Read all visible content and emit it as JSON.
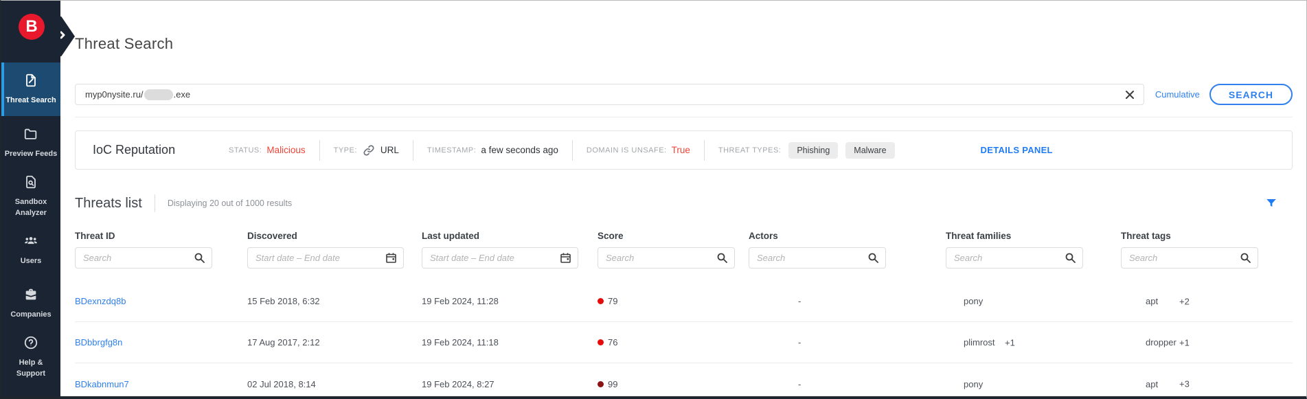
{
  "colors": {
    "sidebar_bg": "#1b2433",
    "sidebar_active_bg": "#1d4a70",
    "accent_blue": "#2f80ed",
    "funnel_blue": "#1f7cf5",
    "logo_red": "#e8192c",
    "status_red": "#f04438",
    "score_high_red": "#e60b0b",
    "score_critical_red": "#8b1313"
  },
  "sidebar": {
    "logo_letter": "B",
    "items": [
      {
        "label": "Threat Search",
        "active": true
      },
      {
        "label": "Preview Feeds",
        "active": false
      },
      {
        "label": "Sandbox Analyzer",
        "active": false
      },
      {
        "label": "Users",
        "active": false
      },
      {
        "label": "Companies",
        "active": false
      },
      {
        "label": "Help & Support",
        "active": false
      }
    ]
  },
  "header": {
    "title": "Threat Search"
  },
  "search": {
    "value_prefix": "myp0nysite.ru/",
    "value_suffix": ".exe",
    "cumulative_label": "Cumulative",
    "search_button_label": "SEARCH"
  },
  "ioc": {
    "title": "IoC Reputation",
    "status_label": "STATUS:",
    "status_value": "Malicious",
    "type_label": "TYPE:",
    "type_value": "URL",
    "timestamp_label": "TIMESTAMP:",
    "timestamp_value": "a few seconds ago",
    "unsafe_label": "DOMAIN IS UNSAFE:",
    "unsafe_value": "True",
    "threat_types_label": "THREAT TYPES:",
    "threat_types": [
      "Phishing",
      "Malware"
    ],
    "details_link_label": "DETAILS PANEL"
  },
  "threats": {
    "title": "Threats list",
    "subtitle": "Displaying 20 out of 1000 results",
    "columns": [
      "Threat ID",
      "Discovered",
      "Last updated",
      "Score",
      "Actors",
      "Threat families",
      "Threat tags"
    ],
    "filters": {
      "search_placeholder": "Search",
      "date_placeholder": "Start date – End date"
    },
    "rows": [
      {
        "id": "BDexnzdq8b",
        "discovered": "15 Feb 2018, 6:32",
        "updated": "19 Feb 2024, 11:28",
        "score": "79",
        "score_color": "#e60b0b",
        "actors": "-",
        "family": "pony",
        "family_extra": "",
        "tag": "apt",
        "tag_extra": "+2"
      },
      {
        "id": "BDbbrgfg8n",
        "discovered": "17 Aug 2017, 2:12",
        "updated": "19 Feb 2024, 11:18",
        "score": "76",
        "score_color": "#e60b0b",
        "actors": "-",
        "family": "plimrost",
        "family_extra": "+1",
        "tag": "dropper",
        "tag_extra": "+1"
      },
      {
        "id": "BDkabnmun7",
        "discovered": "02 Jul 2018, 8:14",
        "updated": "19 Feb 2024, 8:27",
        "score": "99",
        "score_color": "#8b1313",
        "actors": "-",
        "family": "pony",
        "family_extra": "",
        "tag": "apt",
        "tag_extra": "+3"
      }
    ]
  }
}
